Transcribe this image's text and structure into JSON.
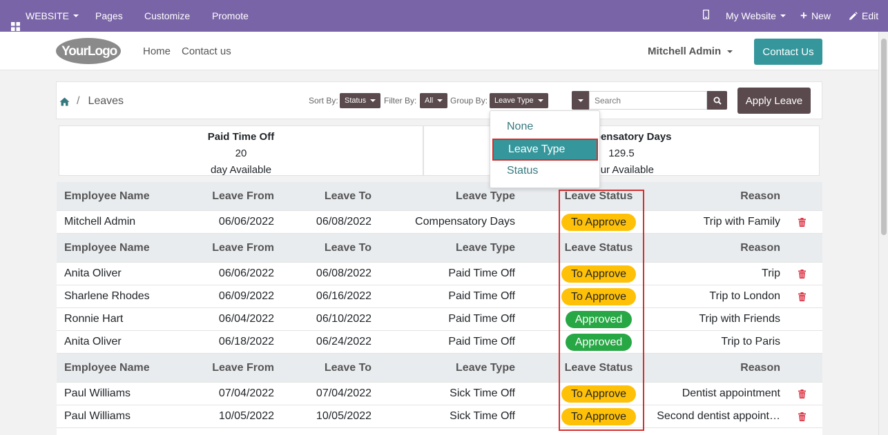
{
  "admin_bar": {
    "website_label": "WEBSITE",
    "pages_label": "Pages",
    "customize_label": "Customize",
    "promote_label": "Promote",
    "my_website_label": "My Website",
    "new_label": "New",
    "edit_label": "Edit"
  },
  "header": {
    "logo_text": "YourLogo",
    "nav": [
      "Home",
      "Contact us"
    ],
    "user_name": "Mitchell Admin",
    "contact_button": "Contact Us"
  },
  "toolbar": {
    "breadcrumb_page": "Leaves",
    "sort_label": "Sort By:",
    "sort_value": "Status",
    "filter_label": "Filter By:",
    "filter_value": "All",
    "group_label": "Group By:",
    "group_value": "Leave Type",
    "search_placeholder": "Search",
    "apply_button": "Apply Leave"
  },
  "group_menu": {
    "options": [
      "None",
      "Leave Type",
      "Status"
    ],
    "selected": "Leave Type"
  },
  "summary": [
    {
      "title": "Paid Time Off",
      "value": "20",
      "unit": "day Available"
    },
    {
      "title": "Compensatory Days",
      "value": "129.5",
      "unit": "hour Available"
    }
  ],
  "table": {
    "headers": [
      "Employee Name",
      "Leave From",
      "Leave To",
      "Leave Type",
      "Leave Status",
      "Reason"
    ],
    "groups": [
      {
        "rows": [
          {
            "name": "Mitchell Admin",
            "from": "06/06/2022",
            "to": "06/08/2022",
            "type": "Compensatory Days",
            "status": "To Approve",
            "reason": "Trip with Family"
          }
        ]
      },
      {
        "rows": [
          {
            "name": "Anita Oliver",
            "from": "06/06/2022",
            "to": "06/08/2022",
            "type": "Paid Time Off",
            "status": "To Approve",
            "reason": "Trip"
          },
          {
            "name": "Sharlene Rhodes",
            "from": "06/09/2022",
            "to": "06/16/2022",
            "type": "Paid Time Off",
            "status": "To Approve",
            "reason": "Trip to London"
          },
          {
            "name": "Ronnie Hart",
            "from": "06/04/2022",
            "to": "06/10/2022",
            "type": "Paid Time Off",
            "status": "Approved",
            "reason": "Trip with Friends"
          },
          {
            "name": "Anita Oliver",
            "from": "06/18/2022",
            "to": "06/24/2022",
            "type": "Paid Time Off",
            "status": "Approved",
            "reason": "Trip to Paris"
          }
        ]
      },
      {
        "rows": [
          {
            "name": "Paul Williams",
            "from": "07/04/2022",
            "to": "07/04/2022",
            "type": "Sick Time Off",
            "status": "To Approve",
            "reason": "Dentist appointment"
          },
          {
            "name": "Paul Williams",
            "from": "10/05/2022",
            "to": "10/05/2022",
            "type": "Sick Time Off",
            "status": "To Approve",
            "reason": "Second dentist appoint…"
          }
        ]
      }
    ]
  },
  "colors": {
    "admin_bar": "#7a64a8",
    "accent": "#35979c",
    "dark_button": "#5a4a4d",
    "to_approve": "#ffc107",
    "approved": "#28a745",
    "highlight": "#d32f2f"
  }
}
